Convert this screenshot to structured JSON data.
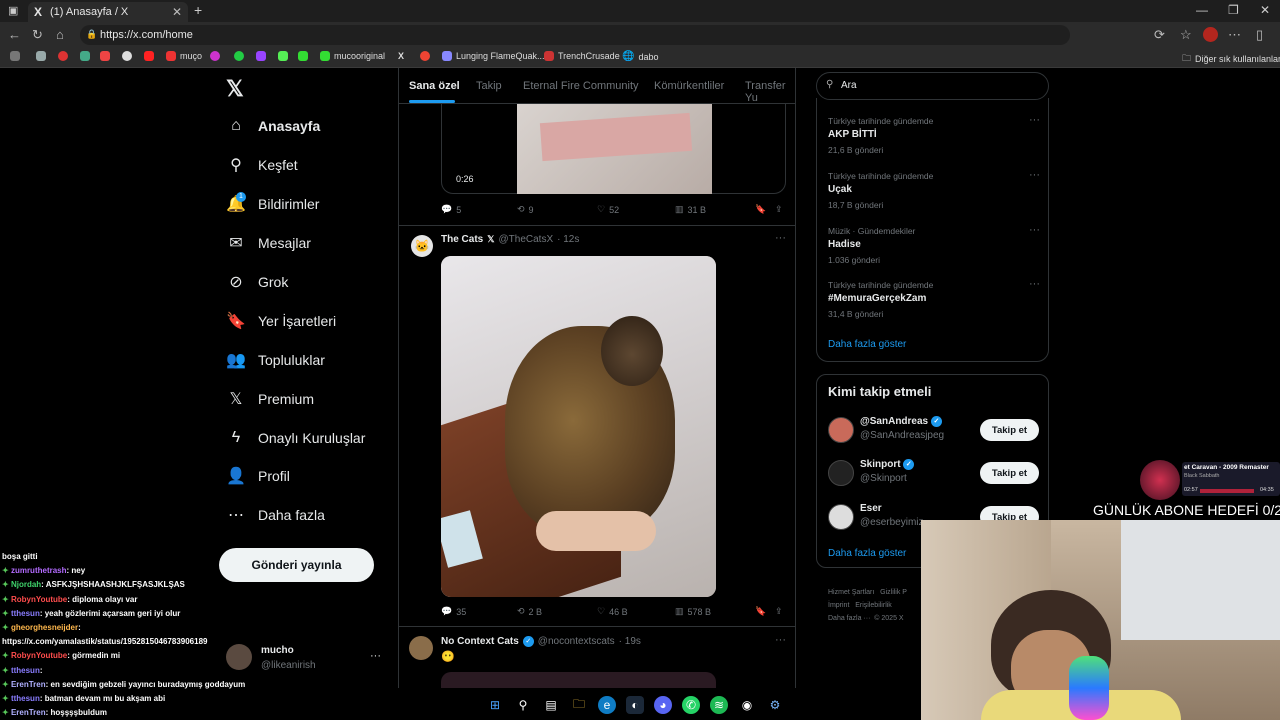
{
  "browser": {
    "tab_title": "(1) Anasayfa / X",
    "tab_icon": "X",
    "url": "https://x.com/home",
    "bookmarks": [
      "muço",
      "mucooriginal",
      "Lunging FlameQuak...",
      "TrenchCrusade",
      "dabo"
    ],
    "other_bookmarks": "Diğer sık kullanılanlar"
  },
  "nav": {
    "items": [
      {
        "label": "Anasayfa",
        "icon": "home-icon",
        "glyph": "⌂"
      },
      {
        "label": "Keşfet",
        "icon": "search-icon",
        "glyph": "⚲"
      },
      {
        "label": "Bildirimler",
        "icon": "bell-icon",
        "glyph": "🔔"
      },
      {
        "label": "Mesajlar",
        "icon": "mail-icon",
        "glyph": "✉"
      },
      {
        "label": "Grok",
        "icon": "grok-icon",
        "glyph": "⊘"
      },
      {
        "label": "Yer İşaretleri",
        "icon": "bookmark-icon",
        "glyph": "🔖"
      },
      {
        "label": "Topluluklar",
        "icon": "communities-icon",
        "glyph": "👥"
      },
      {
        "label": "Premium",
        "icon": "premium-x-icon",
        "glyph": "𝕏"
      },
      {
        "label": "Onaylı Kuruluşlar",
        "icon": "lightning-icon",
        "glyph": "ϟ"
      },
      {
        "label": "Profil",
        "icon": "profile-icon",
        "glyph": "👤"
      },
      {
        "label": "Daha fazla",
        "icon": "more-icon",
        "glyph": "⋯"
      }
    ],
    "notif_badge": "1",
    "post_button": "Gönderi yayınla",
    "account_name": "mucho",
    "account_handle": "@likeanirish"
  },
  "feed": {
    "tabs": [
      "Sana özel",
      "Takip",
      "Eternal Fire Community",
      "Kömürkentliler",
      "Transfer Yu"
    ],
    "top_video_time": "0:26",
    "top_actions": {
      "replies": "5",
      "reposts": "9",
      "likes": "52",
      "views": "31 B"
    },
    "post1": {
      "name": "The Cats",
      "handle": "@TheCatsX",
      "time": "· 12s",
      "actions": {
        "replies": "35",
        "reposts": "2 B",
        "likes": "46 B",
        "views": "578 B"
      }
    },
    "post2": {
      "name": "No Context Cats",
      "handle": "@nocontextscats",
      "time": "· 19s",
      "emoji": "😶"
    }
  },
  "right": {
    "search_placeholder": "Ara",
    "trends": [
      {
        "context": "Türkiye tarihinde gündemde",
        "title": "AKP BİTTİ",
        "count": "21,6 B gönderi"
      },
      {
        "context": "Türkiye tarihinde gündemde",
        "title": "Uçak",
        "count": "18,7 B gönderi"
      },
      {
        "context": "Müzik · Gündemdekiler",
        "title": "Hadise",
        "count": "1.036 gönderi"
      },
      {
        "context": "Türkiye tarihinde gündemde",
        "title": "#MemuraGerçekZam",
        "count": "31,4 B gönderi"
      }
    ],
    "show_more": "Daha fazla göster",
    "who_to_follow_title": "Kimi takip etmeli",
    "follow": [
      {
        "name": "@SanAndreas",
        "handle": "@SanAndreasjpeg"
      },
      {
        "name": "Skinport",
        "handle": "@Skinport"
      },
      {
        "name": "Eser",
        "handle": "@eserbeyimiz"
      }
    ],
    "follow_button": "Takip et",
    "show_more2": "Daha fazla göster",
    "footer": [
      "Hizmet Şartları",
      "Gizlilik P",
      "İmprint",
      "Erişilebilirlik",
      "Daha fazla ···",
      "© 2025 X"
    ]
  },
  "overlay": {
    "goal": "GÜNLÜK ABONE HEDEFİ 0/2",
    "music_title": "et Caravan - 2009 Remaster",
    "music_artist": "Black Sabbath",
    "music_elapsed": "02:57",
    "music_total": "04:35",
    "chat": [
      {
        "user": "",
        "msg": "boşa gitti",
        "color": "#ffffff"
      },
      {
        "user": "zumruthetrash",
        "msg": ": ney",
        "color": "#b36bff"
      },
      {
        "user": "Njordah",
        "msg": ": ASFKJŞHSHAASHJKLFŞASJKLŞAS",
        "color": "#3fd36b"
      },
      {
        "user": "RobynYoutube",
        "msg": ": diploma olayı var",
        "color": "#ff4d4d"
      },
      {
        "user": "tthesun",
        "msg": ": yeah gözlerimi açarsam geri iyi olur",
        "color": "#8a7dff"
      },
      {
        "user": "gheorghesneijder",
        "msg": ":",
        "color": "#ffb84d"
      },
      {
        "user": "",
        "msg": "https://x.com/yamalastik/status/1952815046783906189",
        "color": "#ffffff"
      },
      {
        "user": "RobynYoutube",
        "msg": ": görmedin mi",
        "color": "#ff4d4d"
      },
      {
        "user": "tthesun",
        "msg": ":",
        "color": "#8a7dff"
      },
      {
        "user": "ErenTren",
        "msg": ": en sevdiğim gebzeli yayıncı buradaymış goddayum",
        "color": "#b0b0ff"
      },
      {
        "user": "tthesun",
        "msg": ": batman devam mı bu akşam abi",
        "color": "#8a7dff"
      },
      {
        "user": "ErenTren",
        "msg": ": hoşşşşbuldum",
        "color": "#b0b0ff"
      }
    ]
  }
}
